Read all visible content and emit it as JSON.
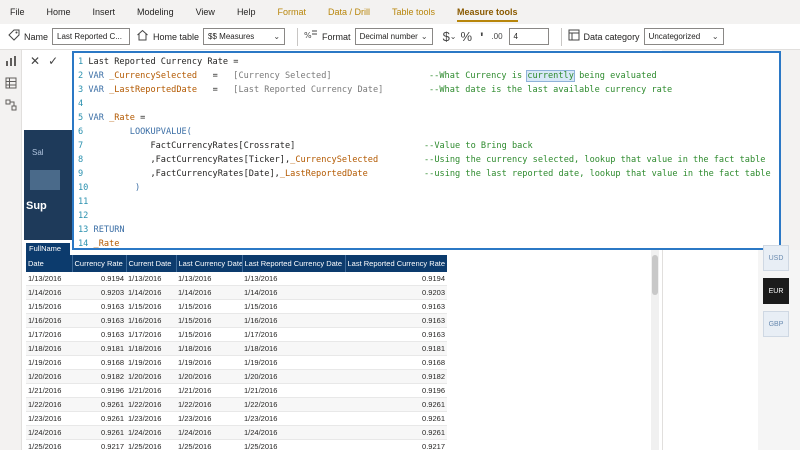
{
  "ribbon": {
    "tabs": [
      {
        "label": "File"
      },
      {
        "label": "Home"
      },
      {
        "label": "Insert"
      },
      {
        "label": "Modeling"
      },
      {
        "label": "View"
      },
      {
        "label": "Help"
      },
      {
        "label": "Format"
      },
      {
        "label": "Data / Drill"
      },
      {
        "label": "Table tools"
      },
      {
        "label": "Measure tools"
      }
    ]
  },
  "toolbar": {
    "name_label": "Name",
    "name_value": "Last Reported C...",
    "home_table_label": "Home table",
    "home_table_value": "$$ Measures",
    "format_label": "Format",
    "format_value": "Decimal number",
    "currency_symbol": "$",
    "percent_symbol": "%",
    "comma_symbol": "'",
    "decimals_symbol": ".00",
    "decimals_value": "4",
    "data_category_label": "Data category",
    "data_category_value": "Uncategorized"
  },
  "formula": {
    "lines": [
      {
        "n": "1",
        "code": "Last Reported Currency Rate ="
      },
      {
        "n": "2",
        "kw": "VAR",
        "var": " _CurrencySelected",
        "eq": "   =   ",
        "ref": "[Currency Selected]",
        "cm": "--What Currency is currently being evaluated"
      },
      {
        "n": "3",
        "kw": "VAR",
        "var": " _LastReportedDate",
        "eq": "   =   ",
        "ref": "[Last Reported Currency Date]",
        "cm": "--What date is the last available currency rate"
      },
      {
        "n": "4",
        "code": ""
      },
      {
        "n": "5",
        "kw": "VAR",
        "var": " _Rate",
        "eq": " =",
        "ref": "",
        "cm": ""
      },
      {
        "n": "6",
        "code": "        LOOKUPVALUE("
      },
      {
        "n": "7",
        "code": "            FactCurrencyRates[Crossrate]",
        "cm": "--Value to Bring back"
      },
      {
        "n": "8",
        "code": "            ,FactCurrencyRates[Ticker],",
        "var": "_CurrencySelected",
        "cm": "--Using the currency selected, lookup that value in the fact table"
      },
      {
        "n": "9",
        "code": "            ,FactCurrencyRates[Date],",
        "var": "_LastReportedDate",
        "cm": "--using the last reported date, lookup that value in the fact table"
      },
      {
        "n": "10",
        "code": "        )"
      },
      {
        "n": "11",
        "code": ""
      },
      {
        "n": "12",
        "code": ""
      },
      {
        "n": "13",
        "kw": "RETURN",
        "code": ""
      },
      {
        "n": "14",
        "var": "_Rate",
        "code": ""
      }
    ]
  },
  "visual_thumb": {
    "text1": "Sal",
    "text2": "Sup"
  },
  "table": {
    "tag": "FullName",
    "columns": [
      "Date",
      "Currency Rate",
      "Current Date",
      "Last Currency Date",
      "Last Reported Currency Date",
      "Last Reported Currency Rate"
    ],
    "rows": [
      [
        "1/13/2016",
        "0.9194",
        "1/13/2016",
        "1/13/2016",
        "1/13/2016",
        "0.9194"
      ],
      [
        "1/14/2016",
        "0.9203",
        "1/14/2016",
        "1/14/2016",
        "1/14/2016",
        "0.9203"
      ],
      [
        "1/15/2016",
        "0.9163",
        "1/15/2016",
        "1/15/2016",
        "1/15/2016",
        "0.9163"
      ],
      [
        "1/16/2016",
        "0.9163",
        "1/16/2016",
        "1/15/2016",
        "1/16/2016",
        "0.9163"
      ],
      [
        "1/17/2016",
        "0.9163",
        "1/17/2016",
        "1/15/2016",
        "1/17/2016",
        "0.9163"
      ],
      [
        "1/18/2016",
        "0.9181",
        "1/18/2016",
        "1/18/2016",
        "1/18/2016",
        "0.9181"
      ],
      [
        "1/19/2016",
        "0.9168",
        "1/19/2016",
        "1/19/2016",
        "1/19/2016",
        "0.9168"
      ],
      [
        "1/20/2016",
        "0.9182",
        "1/20/2016",
        "1/20/2016",
        "1/20/2016",
        "0.9182"
      ],
      [
        "1/21/2016",
        "0.9196",
        "1/21/2016",
        "1/21/2016",
        "1/21/2016",
        "0.9196"
      ],
      [
        "1/22/2016",
        "0.9261",
        "1/22/2016",
        "1/22/2016",
        "1/22/2016",
        "0.9261"
      ],
      [
        "1/23/2016",
        "0.9261",
        "1/23/2016",
        "1/23/2016",
        "1/23/2016",
        "0.9261"
      ],
      [
        "1/24/2016",
        "0.9261",
        "1/24/2016",
        "1/24/2016",
        "1/24/2016",
        "0.9261"
      ],
      [
        "1/25/2016",
        "0.9217",
        "1/25/2016",
        "1/25/2016",
        "1/25/2016",
        "0.9217"
      ]
    ]
  },
  "slicer": {
    "items": [
      {
        "label": "USD",
        "selected": false
      },
      {
        "label": "EUR",
        "selected": true
      },
      {
        "label": "GBP",
        "selected": false
      }
    ]
  },
  "colors": {
    "accent": "#2b78c5",
    "table_header": "#0c3b6d",
    "context_tab": "#b8860b"
  }
}
